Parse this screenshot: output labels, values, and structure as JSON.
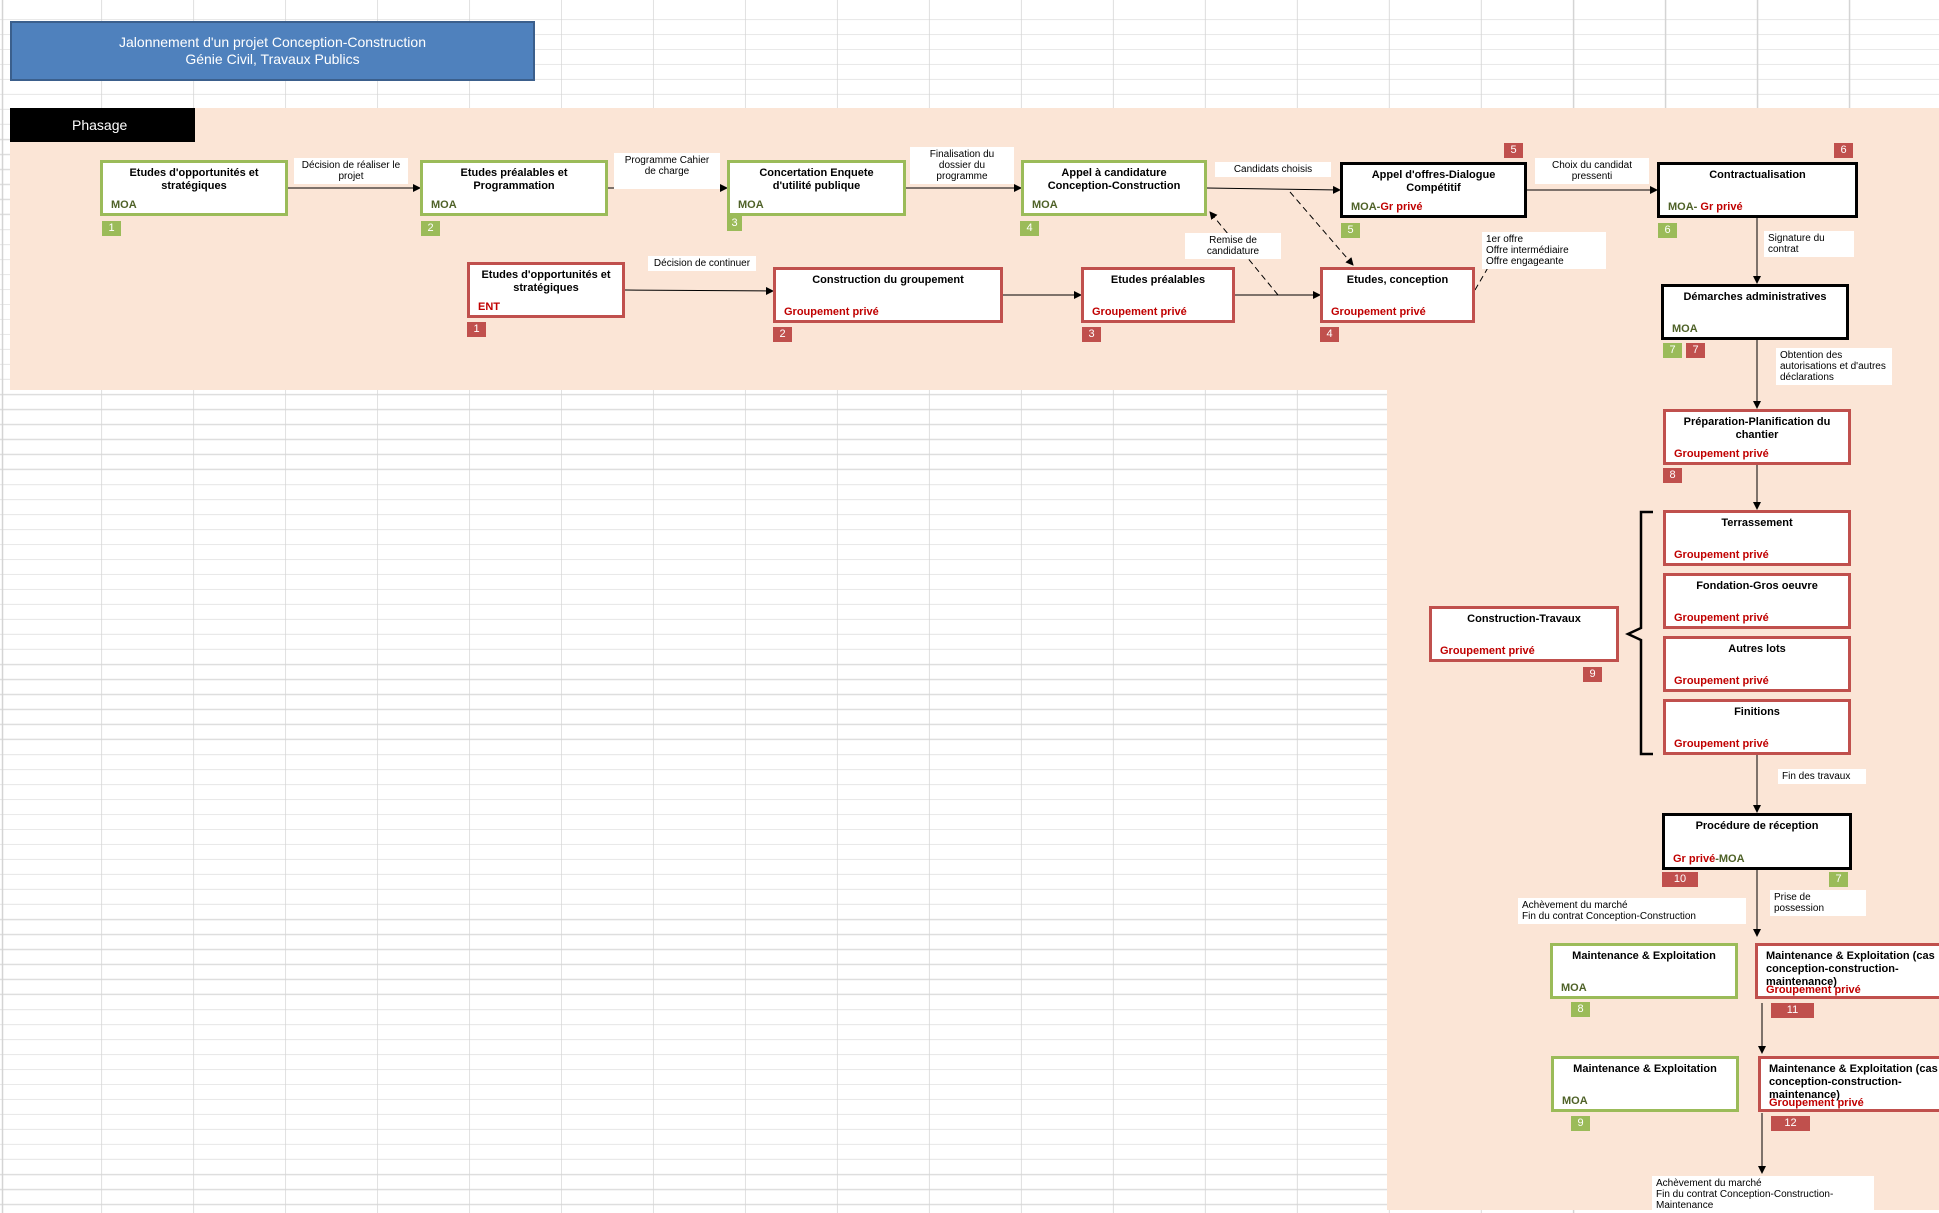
{
  "header": {
    "title_line1": "Jalonnement d'un projet Conception-Construction",
    "title_line2": "Génie Civil, Travaux Publics",
    "phasage": "Phasage"
  },
  "top_row": [
    {
      "title": "Etudes d'opportunités  et stratégiques",
      "who": "MOA",
      "num": "1"
    },
    {
      "title": "Etudes  préalables et Programmation",
      "who": "MOA",
      "num": "2"
    },
    {
      "title": "Concertation Enquete d'utilité publique",
      "who": "MOA",
      "num": "3"
    },
    {
      "title": "Appel  à candidature Conception-Construction",
      "who": "MOA",
      "num": "4"
    },
    {
      "title": "Appel  d'offres-Dialogue Compétitif",
      "who_green": "MOA-",
      "who_red": "Gr privé",
      "num_green": "5",
      "num_red": "5"
    },
    {
      "title": "Contractualisation",
      "who_green": "MOA-",
      "who_red": " Gr privé",
      "num_green": "6",
      "num_red": "6"
    }
  ],
  "second_row": [
    {
      "title": "Etudes d'opportunités et stratégiques",
      "who": "ENT",
      "num": "1"
    },
    {
      "title": "Construction  du groupement",
      "who": "Groupement privé",
      "num": "2"
    },
    {
      "title": "Etudes  préalables",
      "who": "Groupement privé",
      "num": "3"
    },
    {
      "title": "Etudes, conception",
      "who": "Groupement privé",
      "num": "4"
    }
  ],
  "top_labels": [
    "Décision de réaliser le projet",
    "Programme Cahier de charge",
    "Finalisation du dossier du programme",
    "Candidats choisis",
    "Choix du candidat pressenti"
  ],
  "mid_labels": {
    "continuer": "Décision de continuer",
    "remise": "Remise de candidature",
    "offres_line1": "1er offre",
    "offres_line2": "Offre intermédiaire",
    "offres_line3": "Offre engageante"
  },
  "right_col": {
    "signature": "Signature du contrat",
    "demarches": {
      "title": "Démarches administratives",
      "who": "MOA",
      "num_green": "7",
      "num_red": "7"
    },
    "obtention": "Obtention des autorisations et d'autres déclarations",
    "preparation": {
      "title": "Préparation-Planification  du chantier",
      "who": "Groupement privé",
      "num": "8"
    },
    "lots": [
      {
        "title": "Terrassement",
        "who": "Groupement privé"
      },
      {
        "title": "Fondation-Gros oeuvre",
        "who": "Groupement privé"
      },
      {
        "title": "Autres lots",
        "who": "Groupement privé"
      },
      {
        "title": "Finitions",
        "who": "Groupement privé"
      }
    ],
    "construction": {
      "title": "Construction-Travaux",
      "who": "Groupement privé",
      "num": "9"
    },
    "fin_travaux": "Fin des travaux",
    "reception": {
      "title": "Procédure de réception",
      "who_red": "Gr privé",
      "who_green": "-MOA",
      "num_red": "10",
      "num_green": "7"
    },
    "achevement1_line1": "Achèvement du marché",
    "achevement1_line2": "Fin du contrat Conception-Construction",
    "prise": "Prise de possession",
    "maint1": {
      "title": "Maintenance  & Exploitation",
      "who": "MOA",
      "num": "8"
    },
    "maint1b": {
      "title": "Maintenance  & Exploitation (cas conception-construction-maintenance)",
      "who": "Groupement privé",
      "num": "11"
    },
    "maint2": {
      "title": "Maintenance  & Exploitation",
      "who": "MOA",
      "num": "9"
    },
    "maint2b": {
      "title": "Maintenance  & Exploitation (cas conception-construction-maintenance)",
      "who": "Groupement privé",
      "num": "12"
    },
    "achevement2_line1": "Achèvement du marché",
    "achevement2_line2": "Fin du contrat Conception-Construction-",
    "achevement2_line3": "Maintenance"
  }
}
